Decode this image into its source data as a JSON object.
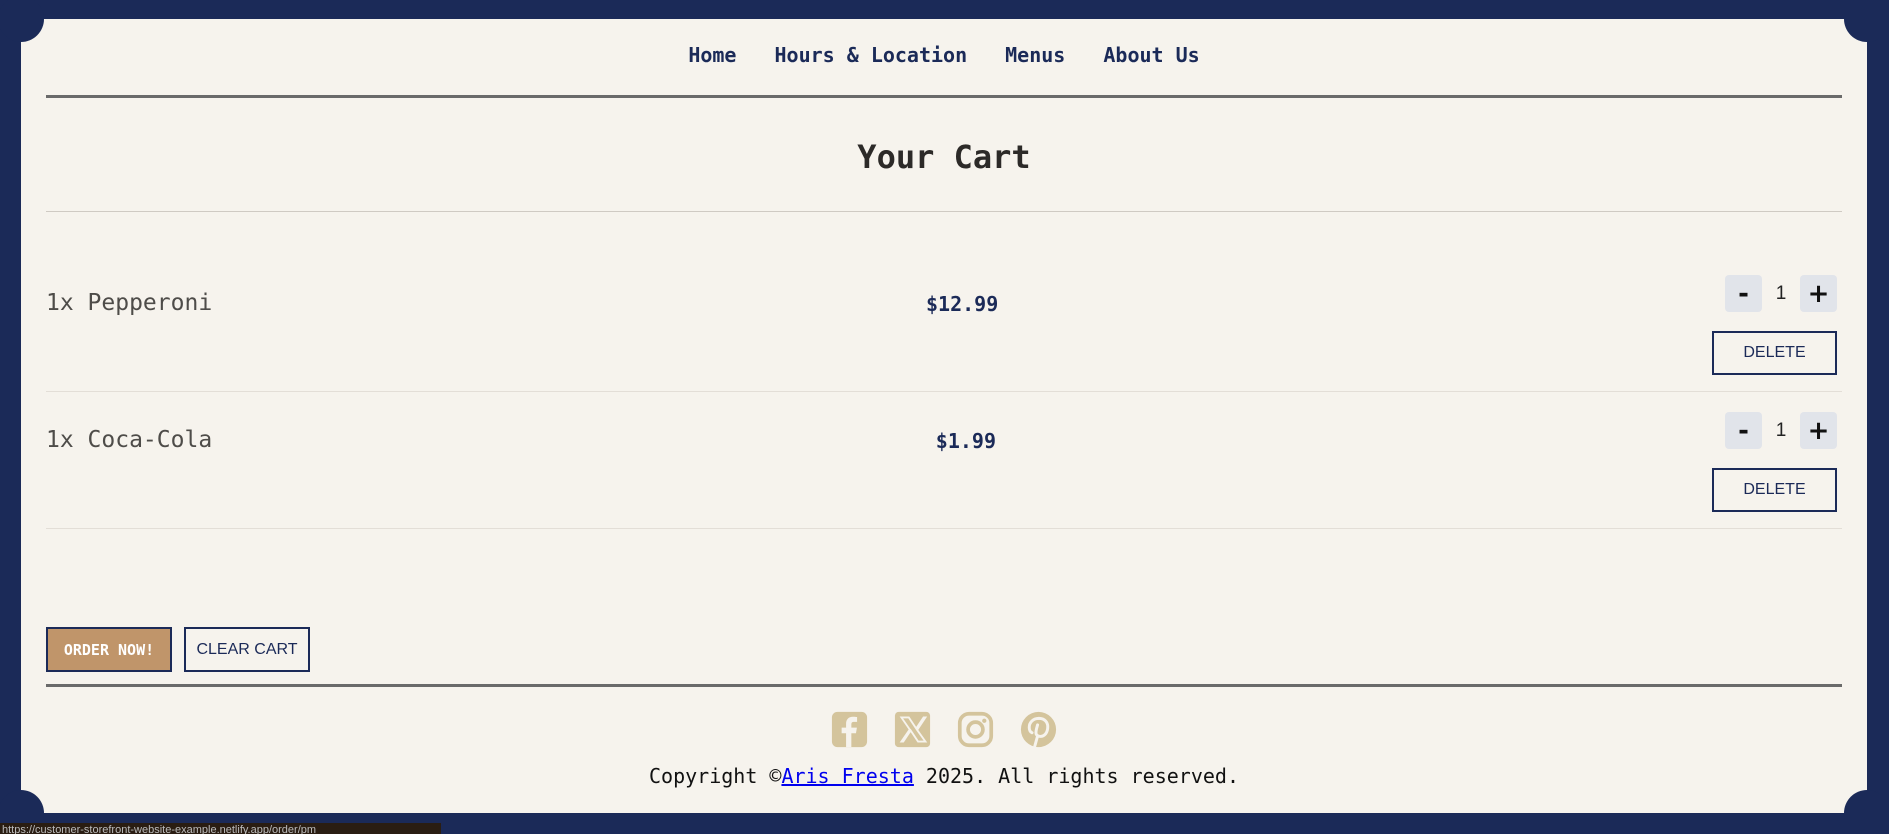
{
  "nav": {
    "items": [
      "Home",
      "Hours & Location",
      "Menus",
      "About Us"
    ]
  },
  "page_title": "Your Cart",
  "cart": {
    "items": [
      {
        "name": "1x Pepperoni",
        "price": "$12.99",
        "qty": "1",
        "minus": "-",
        "plus": "+",
        "delete": "DELETE"
      },
      {
        "name": "1x Coca-Cola",
        "price": "$1.99",
        "qty": "1",
        "minus": "-",
        "plus": "+",
        "delete": "DELETE"
      }
    ]
  },
  "actions": {
    "order_label": "ORDER NOW!",
    "clear_label": "CLEAR CART"
  },
  "footer": {
    "socials": [
      "facebook-icon",
      "x-twitter-icon",
      "instagram-icon",
      "pinterest-icon"
    ],
    "copyright_prefix": "Copyright ©",
    "author": "Aris Fresta",
    "copyright_suffix": " 2025. All rights reserved."
  },
  "status_bar": {
    "url": "https://customer-storefront-website-example.netlify.app/order/pm"
  },
  "colors": {
    "frame": "#1b2a58",
    "card": "#f6f3ed",
    "accent": "#c0956a",
    "social_icon": "#d4c49c"
  }
}
